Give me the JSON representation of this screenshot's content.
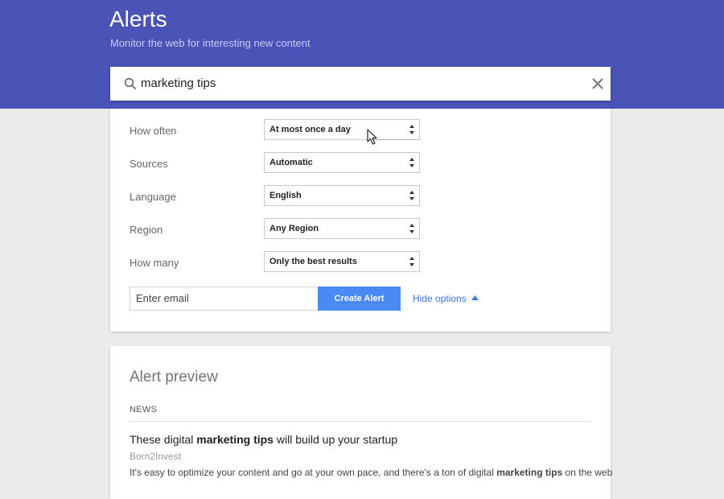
{
  "header": {
    "title": "Alerts",
    "subtitle": "Monitor the web for interesting new content"
  },
  "search": {
    "value": "marketing tips"
  },
  "options": [
    {
      "label": "How often",
      "value": "At most once a day"
    },
    {
      "label": "Sources",
      "value": "Automatic"
    },
    {
      "label": "Language",
      "value": "English"
    },
    {
      "label": "Region",
      "value": "Any Region"
    },
    {
      "label": "How many",
      "value": "Only the best results"
    }
  ],
  "email": {
    "placeholder": "Enter email"
  },
  "create_button": "Create Alert",
  "hide_options": "Hide options",
  "preview": {
    "title": "Alert preview",
    "section": "NEWS",
    "result": {
      "title_pre": "These digital ",
      "title_bold": "marketing tips",
      "title_post": " will build up your startup",
      "source": "Born2Invest",
      "snippet_pre": "It's easy to optimize your content and go at your own pace, and there's a ton of digital ",
      "snippet_bold": "marketing tips",
      "snippet_post": " on the web"
    }
  },
  "colors": {
    "header_bg": "#4a54b7",
    "button_bg": "#4a8af4",
    "link": "#3b78e7"
  }
}
